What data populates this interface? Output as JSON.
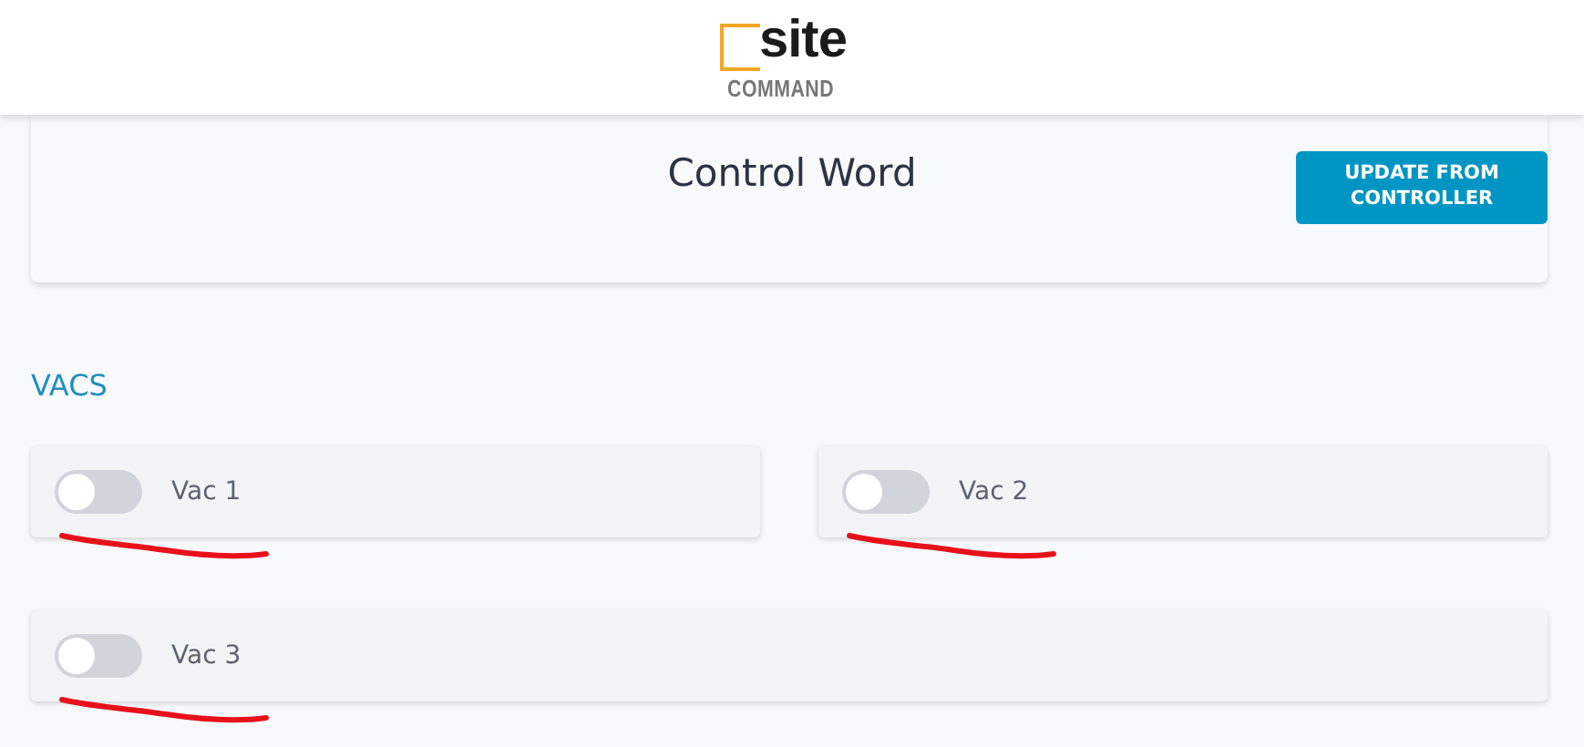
{
  "logo": {
    "top": "site",
    "bottom": "COMMAND"
  },
  "page": {
    "title": "Control Word",
    "button": "UPDATE FROM CONTROLLER"
  },
  "vacs": {
    "heading": "VACS",
    "items": [
      {
        "label": "Vac 1",
        "on": false,
        "underlined": true
      },
      {
        "label": "Vac 2",
        "on": false,
        "underlined": true
      },
      {
        "label": "Vac 3",
        "on": false,
        "underlined": true
      }
    ]
  }
}
